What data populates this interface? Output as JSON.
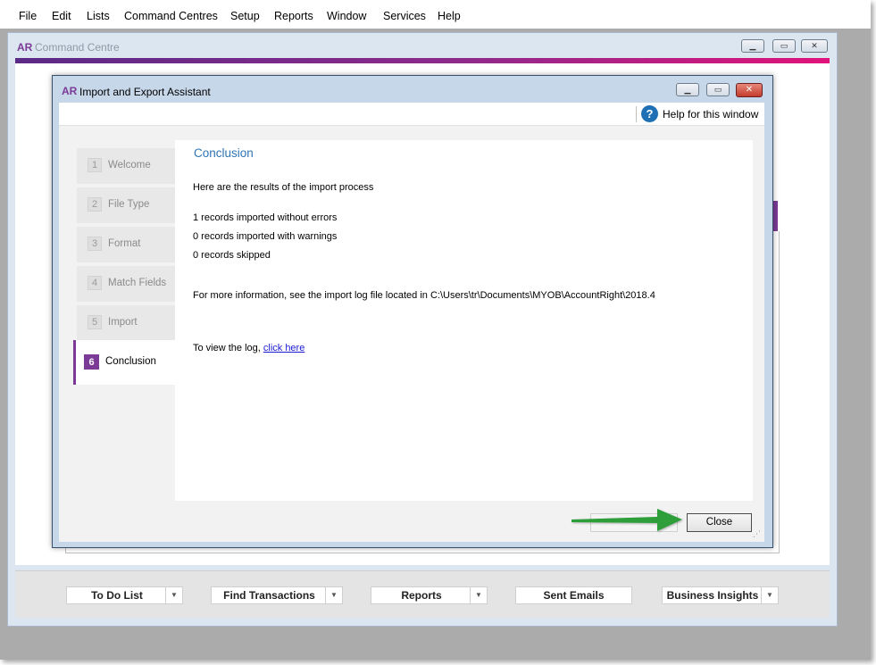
{
  "menubar": {
    "items": [
      "File",
      "Edit",
      "Lists",
      "Command Centres",
      "Setup",
      "Reports",
      "Window",
      "Services",
      "Help"
    ]
  },
  "command_centre": {
    "app_badge": "AR",
    "title": "Command Centre",
    "bottom_buttons": [
      {
        "label": "To Do List",
        "has_dropdown": true
      },
      {
        "label": "Find Transactions",
        "has_dropdown": true
      },
      {
        "label": "Reports",
        "has_dropdown": true
      },
      {
        "label": "Sent Emails",
        "has_dropdown": false
      },
      {
        "label": "Business Insights",
        "has_dropdown": true
      }
    ]
  },
  "dialog": {
    "app_badge": "AR",
    "title": "Import and Export Assistant",
    "help_icon_glyph": "?",
    "help_label": "Help for this window",
    "steps": [
      {
        "num": "1",
        "label": "Welcome"
      },
      {
        "num": "2",
        "label": "File Type"
      },
      {
        "num": "3",
        "label": "Format"
      },
      {
        "num": "4",
        "label": "Match Fields"
      },
      {
        "num": "5",
        "label": "Import"
      },
      {
        "num": "6",
        "label": "Conclusion"
      }
    ],
    "active_step": 6,
    "content": {
      "heading": "Conclusion",
      "intro": "Here are the results of the import process",
      "result_1": "1 records imported without errors",
      "result_2": "0 records imported with warnings",
      "result_3": "0 records skipped",
      "info": "For more information, see the import log file located in C:\\Users\\tr\\Documents\\MYOB\\AccountRight\\2018.4",
      "log_prefix": "To view the log, ",
      "log_link": "click here"
    },
    "close_label": "Close"
  },
  "colors": {
    "accent_purple": "#7b3a96",
    "heading_blue": "#2f75b5",
    "link_blue": "#1a1ad6",
    "arrow_green": "#2e9e3a",
    "help_blue": "#1f6fb4"
  }
}
